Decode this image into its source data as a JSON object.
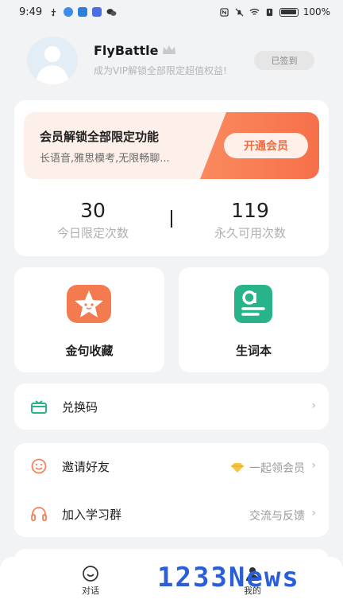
{
  "status_bar": {
    "time": "9:49",
    "battery_percent": "100%"
  },
  "profile": {
    "username": "FlyBattle",
    "subtitle": "成为VIP解锁全部限定超值权益!",
    "signin_label": "已签到"
  },
  "vip": {
    "title": "会员解锁全部限定功能",
    "description": "长语音,雅思模考,无限畅聊...",
    "button_label": "开通会员",
    "stats": [
      {
        "value": "30",
        "label": "今日限定次数"
      },
      {
        "value": "119",
        "label": "永久可用次数"
      }
    ]
  },
  "features": [
    {
      "label": "金句收藏",
      "icon": "star-icon",
      "color": "#f47a4f"
    },
    {
      "label": "生词本",
      "icon": "vocabulary-book-icon",
      "color": "#28b38a"
    }
  ],
  "redeem": {
    "label": "兑换码",
    "icon": "gift-icon"
  },
  "menu": [
    {
      "label": "邀请好友",
      "icon": "smile-icon",
      "trailing": "一起领会员",
      "trailing_icon": "diamond-icon"
    },
    {
      "label": "加入学习群",
      "icon": "headset-icon",
      "trailing": "交流与反馈"
    }
  ],
  "bottom_nav": {
    "items": [
      {
        "label": "对话",
        "icon": "chat-smile-icon"
      },
      {
        "label": "我的",
        "icon": "profile-icon"
      }
    ]
  },
  "watermark": "1233News",
  "colors": {
    "accent_orange": "#f26a3f",
    "accent_green": "#28b38a",
    "background": "#f2f3f5"
  }
}
